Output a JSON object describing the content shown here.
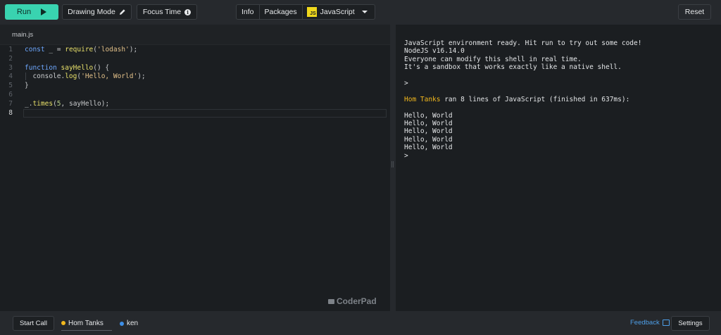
{
  "toolbar": {
    "run_label": "Run",
    "drawing_mode_label": "Drawing Mode",
    "focus_time_label": "Focus Time",
    "info_label": "Info",
    "packages_label": "Packages",
    "language_badge": "JS",
    "language_label": "JavaScript",
    "reset_label": "Reset"
  },
  "editor": {
    "file_tab": "main.js",
    "active_line": 8,
    "lines": [
      {
        "n": "1",
        "tokens": [
          [
            "kw",
            "const"
          ],
          [
            "p",
            " _ = "
          ],
          [
            "fn",
            "require"
          ],
          [
            "p",
            "("
          ],
          [
            "str",
            "'lodash'"
          ],
          [
            "p",
            ");"
          ]
        ]
      },
      {
        "n": "2",
        "tokens": []
      },
      {
        "n": "3",
        "tokens": [
          [
            "kw",
            "function"
          ],
          [
            "p",
            " "
          ],
          [
            "fn",
            "sayHello"
          ],
          [
            "p",
            "() {"
          ]
        ]
      },
      {
        "n": "4",
        "tokens": [
          [
            "p",
            "  console."
          ],
          [
            "fn",
            "log"
          ],
          [
            "p",
            "("
          ],
          [
            "str",
            "'Hello, World'"
          ],
          [
            "p",
            ");"
          ]
        ]
      },
      {
        "n": "5",
        "tokens": [
          [
            "p",
            "}"
          ]
        ]
      },
      {
        "n": "6",
        "tokens": []
      },
      {
        "n": "7",
        "tokens": [
          [
            "p",
            "_."
          ],
          [
            "fn",
            "times"
          ],
          [
            "p",
            "("
          ],
          [
            "num",
            "5"
          ],
          [
            "p",
            ", sayHello);"
          ]
        ]
      },
      {
        "n": "8",
        "tokens": []
      }
    ]
  },
  "brand": {
    "logo_text": "CoderPad"
  },
  "console": {
    "intro": [
      "JavaScript environment ready. Hit run to try out some code!",
      "NodeJS v16.14.0",
      "Everyone can modify this shell in real time.",
      "It's a sandbox that works exactly like a native shell."
    ],
    "prompt": ">",
    "run_user": "Hom Tanks",
    "run_message": " ran 8 lines of JavaScript (finished in 637ms):",
    "output": [
      "Hello, World",
      "Hello, World",
      "Hello, World",
      "Hello, World",
      "Hello, World"
    ],
    "final_prompt": ">"
  },
  "footer": {
    "start_call_label": "Start Call",
    "participants": [
      {
        "name": "Hom Tanks",
        "color": "#f2b81d"
      },
      {
        "name": "ken",
        "color": "#3d8fe8"
      }
    ],
    "feedback_label": "Feedback",
    "settings_label": "Settings"
  },
  "colors": {
    "accent": "#39d3b0",
    "link": "#4e9fe8",
    "user": "#f2b81d"
  }
}
